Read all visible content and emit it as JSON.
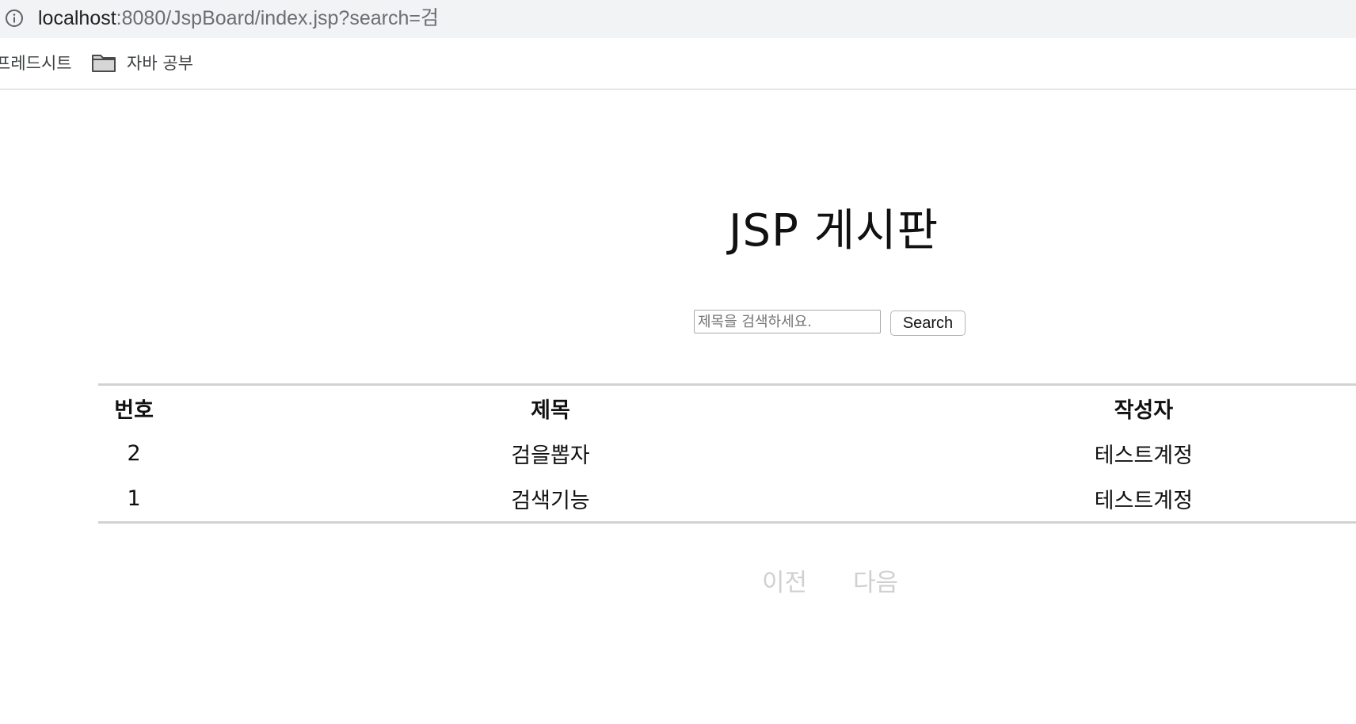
{
  "browser": {
    "url_host": "localhost",
    "url_rest": ":8080/JspBoard/index.jsp?search=검",
    "bookmarks": [
      {
        "label": "프레드시트"
      },
      {
        "label": "자바 공부"
      }
    ]
  },
  "page": {
    "title": "JSP 게시판",
    "search": {
      "placeholder": "제목을 검색하세요.",
      "value": "",
      "button_label": "Search"
    },
    "table": {
      "headers": {
        "num": "번호",
        "title": "제목",
        "author": "작성자"
      },
      "rows": [
        {
          "num": "2",
          "title": "검을뽑자",
          "author": "테스트계정"
        },
        {
          "num": "1",
          "title": "검색기능",
          "author": "테스트계정"
        }
      ]
    },
    "pagination": {
      "prev_label": "이전",
      "next_label": "다음"
    }
  },
  "colors": {
    "address_bar_bg": "#f1f3f4",
    "table_border": "#d2d2d2",
    "pager_disabled": "#d0d0d0"
  },
  "icons": [
    "info-icon",
    "folder-icon"
  ]
}
